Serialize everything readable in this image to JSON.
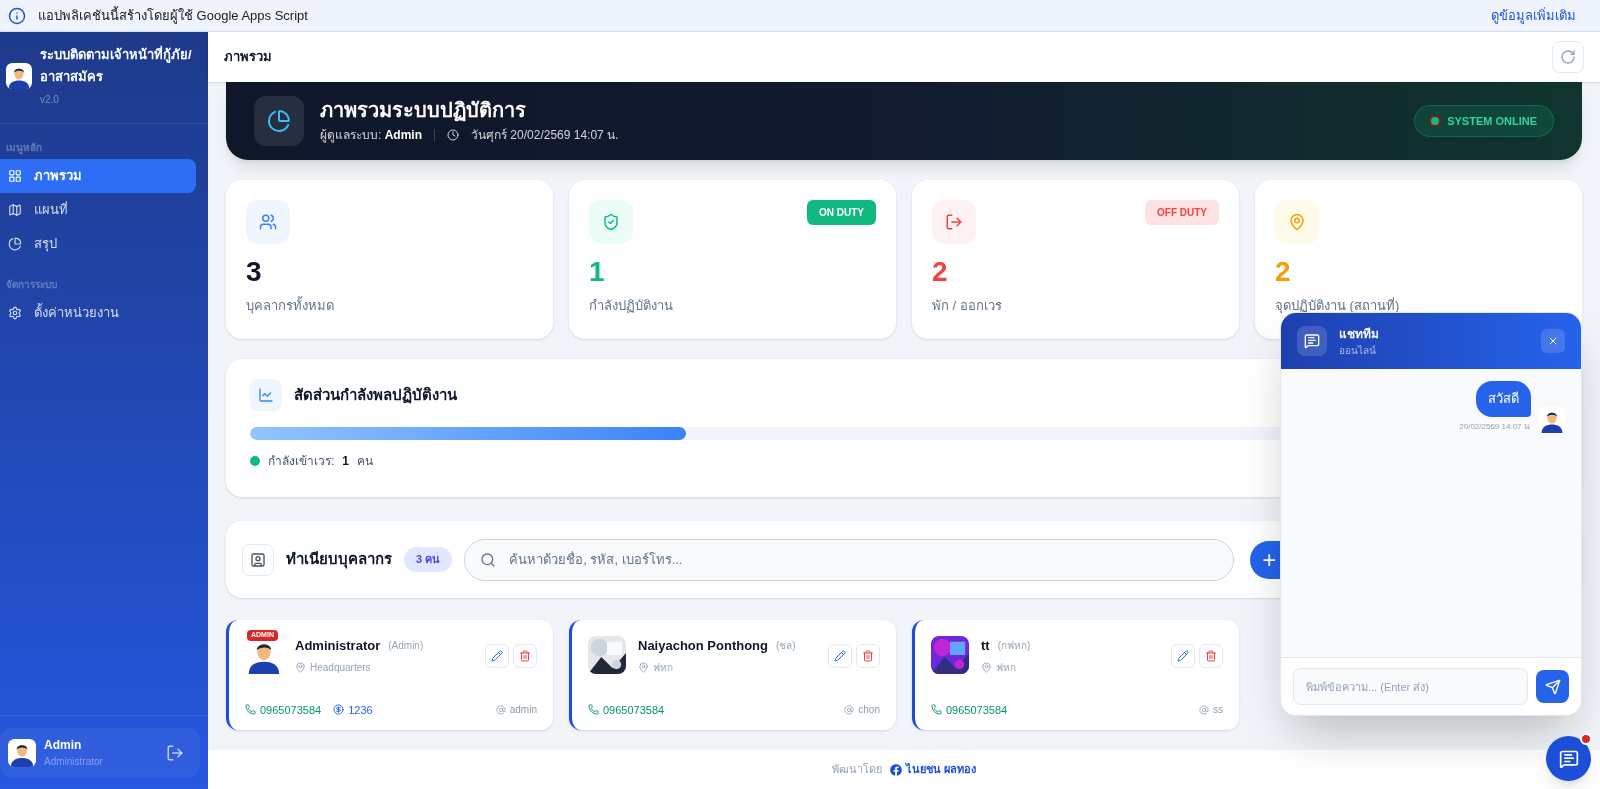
{
  "notice": {
    "text": "แอปพลิเคชันนี้สร้างโดยผู้ใช้ Google Apps Script",
    "link": "ดูข้อมูลเพิ่มเติม"
  },
  "sidebar": {
    "title": "ระบบติดตามเจ้าหน้าที่กู้ภัย/อาสาสมัคร",
    "version": "v2.0",
    "sections": [
      {
        "heading": "เมนูหลัก",
        "items": [
          {
            "label": "ภาพรวม",
            "selected": true
          },
          {
            "label": "แผนที่",
            "selected": false
          },
          {
            "label": "สรุป",
            "selected": false
          }
        ]
      },
      {
        "heading": "จัดการระบบ",
        "items": [
          {
            "label": "ตั้งค่าหน่วยงาน",
            "selected": false
          }
        ]
      }
    ],
    "user": {
      "name": "Admin",
      "role": "Administrator"
    }
  },
  "header": {
    "title": "ภาพรวม"
  },
  "hero": {
    "title": "ภาพรวมระบบปฏิบัติการ",
    "admin_label": "ผู้ดูแลระบบ:",
    "admin_name": "Admin",
    "datetime": "วันศุกร์ 20/02/2569 14:07 น.",
    "status": "SYSTEM ONLINE"
  },
  "stats": [
    {
      "value": "3",
      "label": "บุคลากรทั้งหมด",
      "color": "#0f172a"
    },
    {
      "value": "1",
      "label": "กำลังปฏิบัติงาน",
      "color": "#10b981",
      "badge": {
        "text": "ON DUTY",
        "kind": "solid"
      }
    },
    {
      "value": "2",
      "label": "พัก / ออกเวร",
      "color": "#ef4444",
      "badge": {
        "text": "OFF DUTY",
        "kind": "soft"
      }
    },
    {
      "value": "2",
      "label": "จุดปฏิบัติงาน (สถานที่)",
      "color": "#f59e0b"
    }
  ],
  "ratio": {
    "title": "สัดส่วนกำลังพลปฏิบัติงาน",
    "level": 0.333,
    "legend_label": "กำลังเข้าเวร:",
    "legend_value": "1",
    "legend_unit": "คน"
  },
  "directory": {
    "title": "ทำเนียบบุคลากร",
    "count": "3 คน",
    "search_placeholder": "ค้นหาด้วยชื่อ, รหัส, เบอร์โทร...",
    "add_label": "+"
  },
  "people": [
    {
      "name": "Administrator",
      "role": "(Admin)",
      "location": "Headquarters",
      "phone": "0965073584",
      "code": "1236",
      "username": "admin",
      "kind": "admin",
      "avatar_badge": "ADMIN"
    },
    {
      "name": "Naiyachon Ponthong",
      "role": "(ชล)",
      "location": "ฟหก",
      "phone": "0965073584",
      "username": "chon"
    },
    {
      "name": "tt",
      "role": "(กฟหก)",
      "location": "ฟหก",
      "phone": "0965073584",
      "username": "ss"
    }
  ],
  "footer": {
    "label": "พัฒนาโดย",
    "author": "ไนยชน ผลทอง"
  },
  "chat": {
    "title": "แชททีม",
    "status": "ออนไลน์",
    "messages": [
      {
        "text": "สวัสดี",
        "time": "20/02/2569 14:07 น."
      }
    ],
    "placeholder": "พิมพ์ข้อความ... (Enter ส่ง)",
    "unread": true
  }
}
